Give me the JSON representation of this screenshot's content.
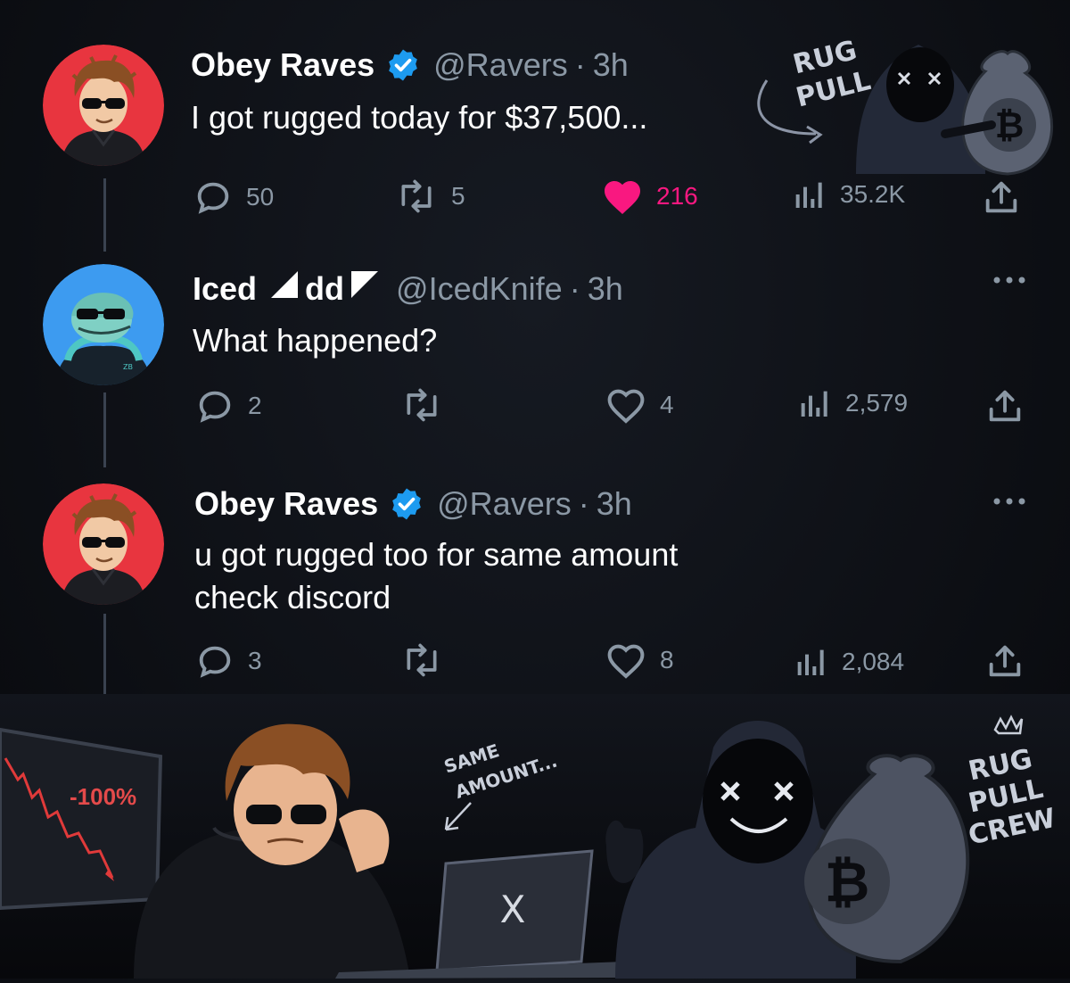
{
  "tweets": [
    {
      "name": "Obey Raves",
      "handle": "@Ravers",
      "time": "3h",
      "verified": true,
      "text": "I got rugged today for $37,500...",
      "replies": "50",
      "reposts": "5",
      "likes": "216",
      "liked": true,
      "views": "35.2K"
    },
    {
      "name_part1": "Iced",
      "name_part2": "dd",
      "handle": "@IcedKnife",
      "time": "3h",
      "verified": false,
      "text": "What happened?",
      "replies": "2",
      "reposts": "",
      "likes": "4",
      "liked": false,
      "views": "2,579"
    },
    {
      "name": "Obey Raves",
      "handle": "@Ravers",
      "time": "3h",
      "verified": true,
      "text": "u got rugged too for same amount\ncheck discord",
      "replies": "3",
      "reposts": "",
      "likes": "8",
      "liked": false,
      "views": "2,084"
    }
  ],
  "separator": "·",
  "sticker_top": {
    "line1": "RUG",
    "line2": "PULL",
    "coin": "₿"
  },
  "scene": {
    "chart_label": "-100%",
    "note_line1": "SAME",
    "note_line2": "AMOUNT...",
    "laptop_logo": "X",
    "crew_line1": "RUG",
    "crew_line2": "PULL",
    "crew_line3": "CREW",
    "bag_coin": "₿"
  },
  "colors": {
    "verified": "#1d9bf0",
    "like": "#f91880",
    "muted": "#8b98a5",
    "avatar_red": "#e8353f",
    "avatar_blue": "#3d9bf0"
  },
  "icons": [
    "reply-icon",
    "repost-icon",
    "heart-icon",
    "views-icon",
    "share-icon",
    "verified-icon",
    "more-icon"
  ]
}
